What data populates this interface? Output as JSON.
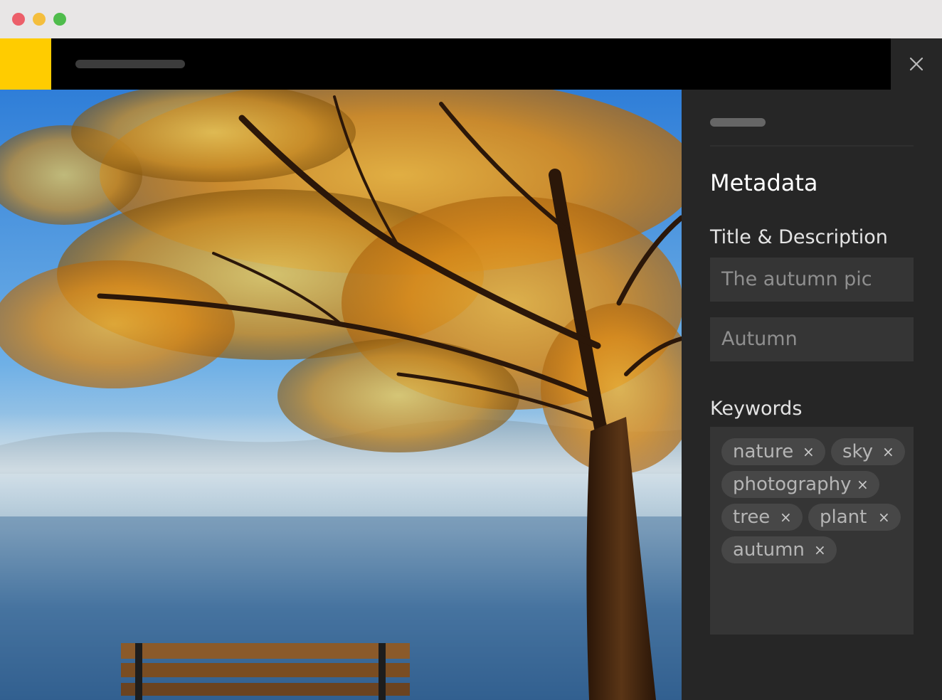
{
  "window": {
    "controls": [
      "close",
      "minimize",
      "maximize"
    ]
  },
  "colors": {
    "brand": "#ffcc00",
    "topbar": "#000000",
    "panel": "#262626",
    "field": "#353535",
    "chip": "#474747"
  },
  "icons": {
    "close": "close-icon"
  },
  "photo": {
    "subject": "autumn tree by a misty lake with a wooden bench"
  },
  "panel": {
    "heading": "Metadata",
    "title_section_label": "Title & Description",
    "title_value": "The autumn pic",
    "description_value": "Autumn",
    "keywords_label": "Keywords",
    "remove_glyph": "×",
    "keywords": [
      "nature",
      "sky",
      "photography",
      "tree",
      "plant",
      "autumn"
    ]
  }
}
